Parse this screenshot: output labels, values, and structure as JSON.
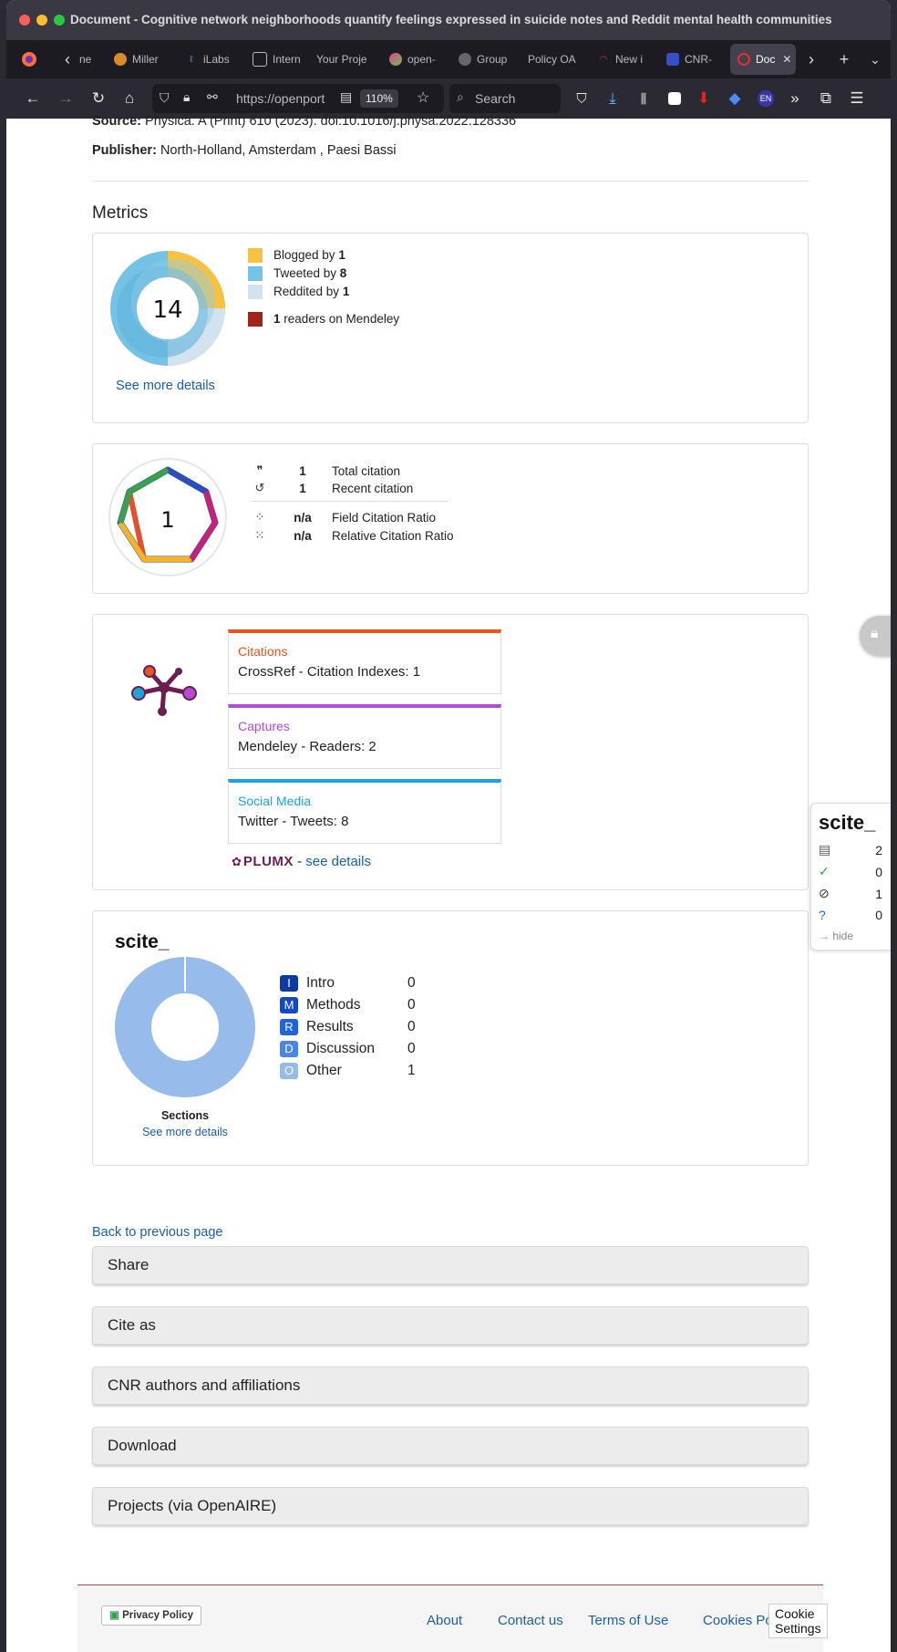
{
  "window": {
    "title": "Document - Cognitive network neighborhoods quantify feelings expressed in suicide notes and Reddit mental health communities"
  },
  "tabs": [
    {
      "label": "ne",
      "icon": "firefox-icon"
    },
    {
      "label": "Miller",
      "icon": "avatar-icon"
    },
    {
      "label": "iLabs",
      "icon": "ilabs-icon"
    },
    {
      "label": "Intern",
      "icon": "page-icon"
    },
    {
      "label": "Your Proje",
      "icon": "blank-icon"
    },
    {
      "label": "open-",
      "icon": "openalex-icon"
    },
    {
      "label": "Group",
      "icon": "circle-icon"
    },
    {
      "label": "Policy OA",
      "icon": "blank-icon"
    },
    {
      "label": "New i",
      "icon": "arc-icon"
    },
    {
      "label": "CNR-",
      "icon": "cnr-icon"
    },
    {
      "label": "Doc",
      "icon": "doc-icon"
    }
  ],
  "navbar": {
    "url": "https://openport",
    "zoom": "110%",
    "search_placeholder": "Search",
    "lang_badge": "EN"
  },
  "meta": {
    "source_label": "Source:",
    "source_value": "Physica. A (Print) 610 (2023). doi:10.1016/j.physa.2022.128336",
    "publisher_label": "Publisher:",
    "publisher_value": "North-Holland, Amsterdam , Paesi Bassi"
  },
  "metrics": {
    "heading": "Metrics",
    "altmetric": {
      "score": "14",
      "rows": [
        {
          "prefix": "Blogged by ",
          "count": "1",
          "suffix": "",
          "color": "#f5c244"
        },
        {
          "prefix": "Tweeted by ",
          "count": "8",
          "suffix": "",
          "color": "#74c2e6"
        },
        {
          "prefix": "Reddited by ",
          "count": "1",
          "suffix": "",
          "color": "#d2e2ee"
        },
        {
          "prefix": "",
          "count": "1",
          "suffix": " readers on Mendeley",
          "color": "#a0241a"
        }
      ],
      "see_more": "See more details"
    },
    "dimensions": {
      "score": "1",
      "rows": [
        {
          "icon": "quote-icon",
          "value": "1",
          "label": "Total citation"
        },
        {
          "icon": "history-icon",
          "value": "1",
          "label": "Recent citation"
        },
        {
          "icon": "field-ratio-icon",
          "value": "n/a",
          "label": "Field Citation Ratio"
        },
        {
          "icon": "relative-ratio-icon",
          "value": "n/a",
          "label": "Relative Citation Ratio"
        }
      ]
    },
    "plumx": {
      "boxes": [
        {
          "title": "Citations",
          "value": "CrossRef - Citation Indexes: 1",
          "color": "#e8561e"
        },
        {
          "title": "Captures",
          "value": "Mendeley - Readers: 2",
          "color": "#b54ad8"
        },
        {
          "title": "Social Media",
          "value": "Twitter - Tweets: 8",
          "color": "#1ea3d8"
        }
      ],
      "logo": "PLUMX",
      "sep": " - ",
      "see_details": "see details"
    },
    "scite": {
      "brand": "scite_",
      "sections_label": "Sections",
      "see_more": "See more details",
      "rows": [
        {
          "letter": "I",
          "label": "Intro",
          "count": "0",
          "color": "#0d3a9e"
        },
        {
          "letter": "M",
          "label": "Methods",
          "count": "0",
          "color": "#1449c4"
        },
        {
          "letter": "R",
          "label": "Results",
          "count": "0",
          "color": "#1e64e0"
        },
        {
          "letter": "D",
          "label": "Discussion",
          "count": "0",
          "color": "#4a86e8"
        },
        {
          "letter": "O",
          "label": "Other",
          "count": "1",
          "color": "#95bbea"
        }
      ],
      "donut_color": "#97bbea"
    }
  },
  "back_link": "Back to previous page",
  "accordions": [
    "Share",
    "Cite as",
    "CNR authors and affiliations",
    "Download",
    "Projects (via OpenAIRE)"
  ],
  "scite_sidebar": {
    "brand": "scite_",
    "rows": [
      {
        "icon": "document-icon",
        "count": "2"
      },
      {
        "icon": "check-circle-icon",
        "count": "0"
      },
      {
        "icon": "compass-icon",
        "count": "1"
      },
      {
        "icon": "question-circle-icon",
        "count": "0"
      }
    ],
    "hide": "hide"
  },
  "footer": {
    "privacy": "Privacy Policy",
    "links": [
      "About",
      "Contact us",
      "Terms of Use",
      "Cookies Policy"
    ],
    "cookie_settings": "Cookie Settings"
  }
}
